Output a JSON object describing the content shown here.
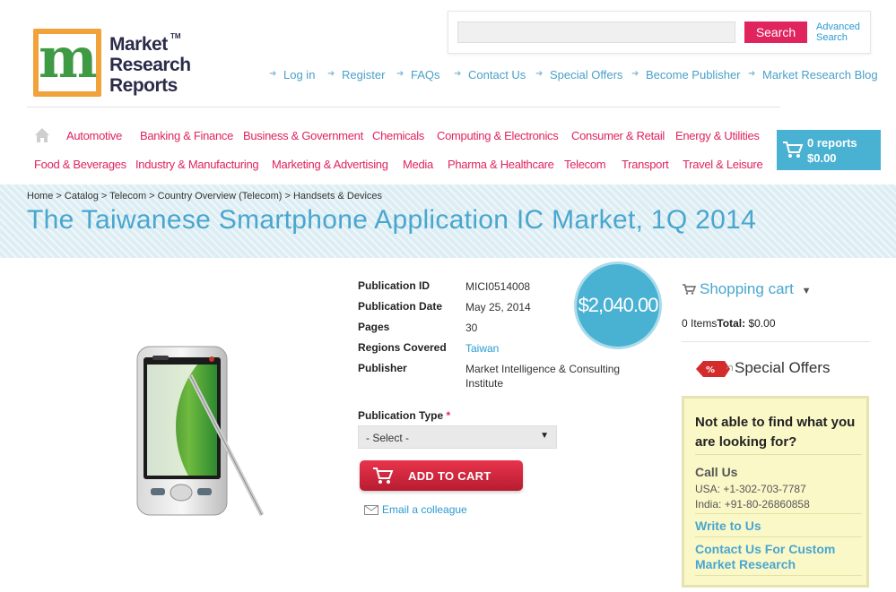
{
  "header": {
    "logo_lines": [
      "Market",
      "Research",
      "Reports"
    ],
    "logo_tm": "TM",
    "search_placeholder": "",
    "search_button": "Search",
    "advanced_search": [
      "Advanced",
      "Search"
    ],
    "top_links": [
      "Log in",
      "Register",
      "FAQs",
      "Contact Us",
      "Special Offers",
      "Become Publisher",
      "Market Research Blog"
    ]
  },
  "categories": {
    "row1": [
      "Automotive",
      "Banking & Finance",
      "Business & Government",
      "Chemicals",
      "Computing & Electronics",
      "Consumer & Retail",
      "Energy & Utilities"
    ],
    "row2": [
      "Food & Beverages",
      "Industry & Manufacturing",
      "Marketing & Advertising",
      "Media",
      "Pharma & Healthcare",
      "Telecom",
      "Transport",
      "Travel & Leisure"
    ]
  },
  "cart": {
    "count": "0 reports",
    "total": "$0.00"
  },
  "breadcrumb": [
    "Home",
    "Catalog",
    "Telecom",
    "Country Overview (Telecom)",
    "Handsets & Devices"
  ],
  "breadcrumb_sep": " > ",
  "title": "The Taiwanese Smartphone Application IC Market, 1Q 2014",
  "details": [
    {
      "label": "Publication ID",
      "value": "MICI0514008"
    },
    {
      "label": "Publication Date",
      "value": "May 25, 2014"
    },
    {
      "label": "Pages",
      "value": "30"
    },
    {
      "label": "Regions Covered",
      "value": "Taiwan"
    },
    {
      "label": "Publisher",
      "value_lines": [
        "Market Intelligence & Consulting",
        "Institute"
      ]
    }
  ],
  "price": "$2,040.00",
  "publication_type": {
    "label": "Publication Type",
    "required": "*",
    "selected": "- Select -"
  },
  "add_to_cart": "ADD TO CART",
  "email_colleague": "Email a colleague",
  "shopping_cart": {
    "title": "Shopping cart",
    "items": "0 Items",
    "total_label": "Total:",
    "total": "$0.00"
  },
  "special_offers": "Special Offers",
  "help_box": {
    "heading": "Not able to find what you are looking for?",
    "call_us": "Call Us",
    "usa": "USA: +1-302-703-7787",
    "india": "India: +91-80-26860858",
    "write": "Write to Us",
    "custom": "Contact Us For Custom Market Research"
  },
  "colors": {
    "accent_pink": "#e0245e",
    "accent_blue": "#49b1d2",
    "link_blue": "#2b9bd1"
  }
}
